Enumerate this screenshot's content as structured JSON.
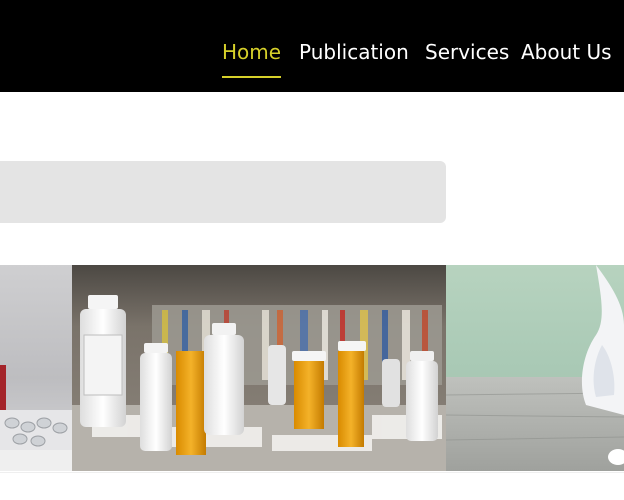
{
  "nav": {
    "items": [
      {
        "label": "Home",
        "active": true
      },
      {
        "label": "Publication",
        "active": false
      },
      {
        "label": "Services",
        "active": false
      },
      {
        "label": "About Us",
        "active": false
      }
    ]
  },
  "colors": {
    "header_bg": "#000000",
    "active": "#d6d02a",
    "nav_text": "#ffffff",
    "search_bg": "#e4e4e4"
  },
  "gallery": {
    "images": [
      "pill-blister-photo",
      "medicine-bottles-photo",
      "cat-photo"
    ]
  }
}
